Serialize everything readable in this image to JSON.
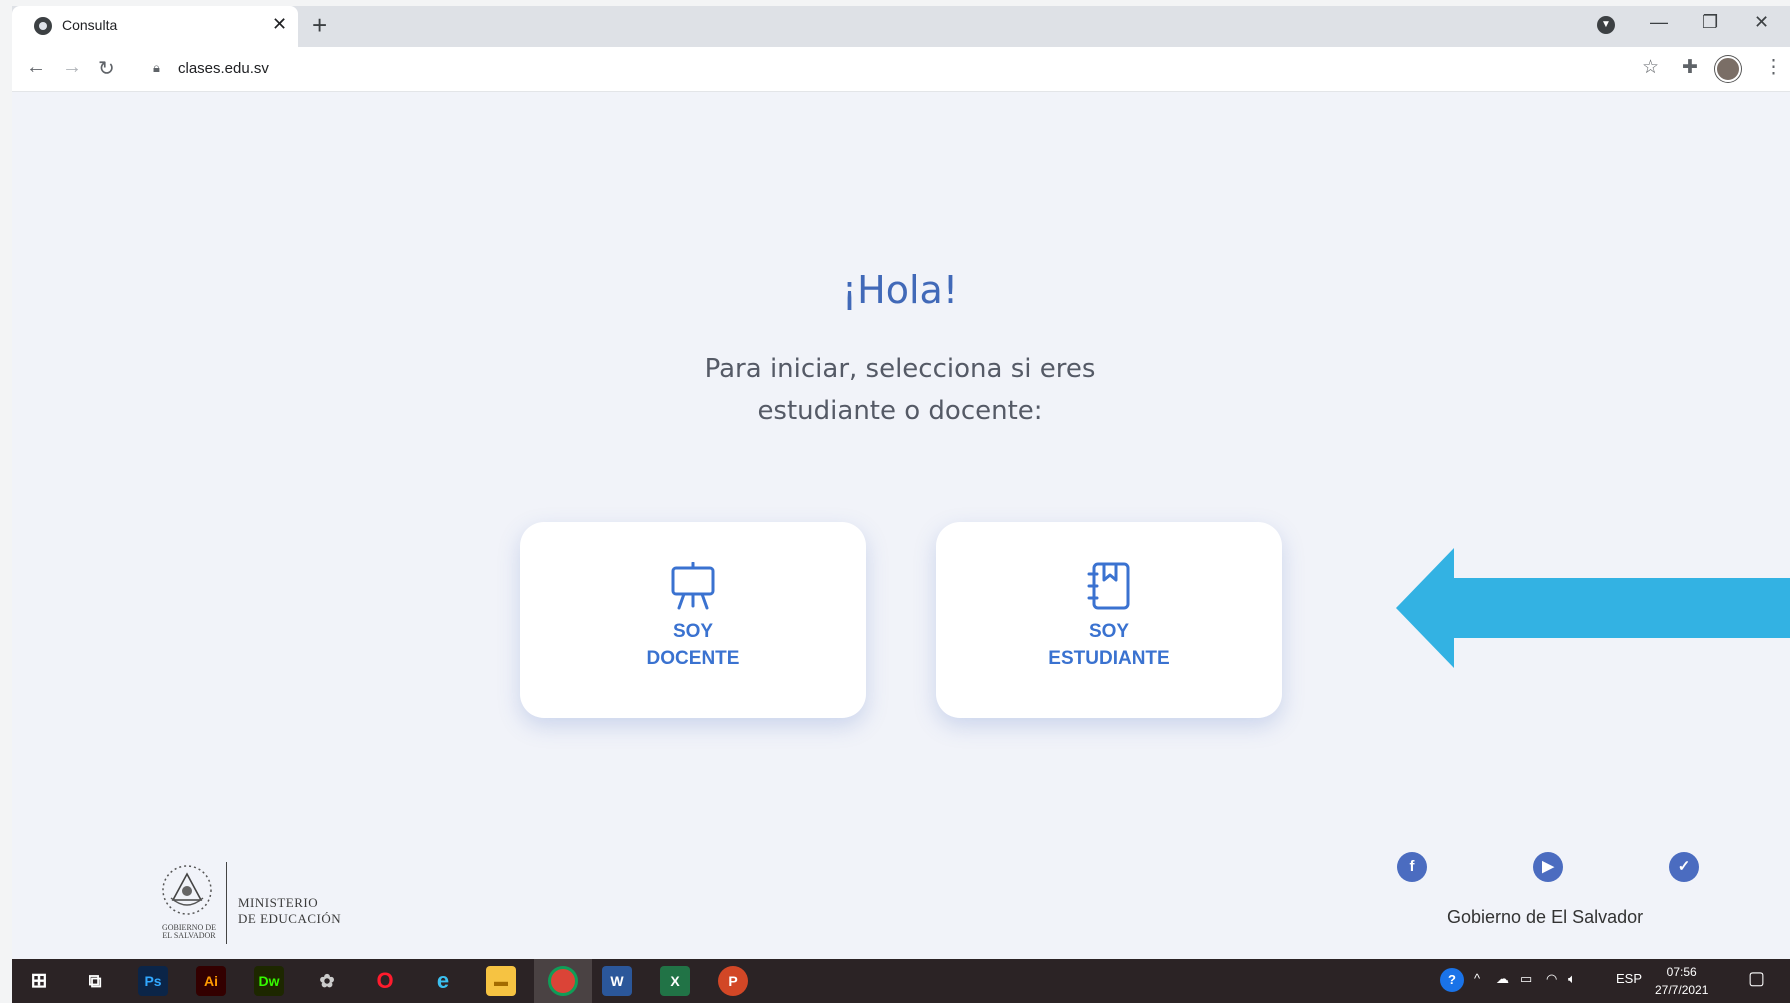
{
  "browser": {
    "tab_title": "Consulta",
    "tab_close": "✕",
    "new_tab": "+",
    "url": "clases.edu.sv",
    "win_min": "—",
    "win_max": "❐",
    "win_close": "✕"
  },
  "main": {
    "greeting": "¡Hola!",
    "instruction_line1": "Para iniciar, selecciona si eres",
    "instruction_line2": "estudiante o docente:",
    "cards": [
      {
        "line1": "SOY",
        "line2": "DOCENTE",
        "icon": "easel-icon"
      },
      {
        "line1": "SOY",
        "line2": "ESTUDIANTE",
        "icon": "notebook-icon"
      }
    ]
  },
  "footer": {
    "ministry_line1": "MINISTERIO",
    "ministry_line2": "DE EDUCACIÓN",
    "seal_caption_line1": "GOBIERNO DE",
    "seal_caption_line2": "EL SALVADOR",
    "government": "Gobierno de El Salvador",
    "social": [
      "facebook-icon",
      "youtube-icon",
      "twitter-icon"
    ]
  },
  "taskbar": {
    "apps": [
      "windows-start",
      "task-view",
      "photoshop",
      "illustrator",
      "dreamweaver",
      "paint",
      "opera",
      "edge",
      "file-explorer",
      "chrome",
      "word",
      "excel",
      "powerpoint"
    ],
    "language": "ESP",
    "time": "07:56",
    "date": "27/7/2021"
  },
  "colors": {
    "accent": "#3a72d0",
    "heading": "#4169b8",
    "arrow": "#33b2e3",
    "background": "#f1f3f9"
  }
}
